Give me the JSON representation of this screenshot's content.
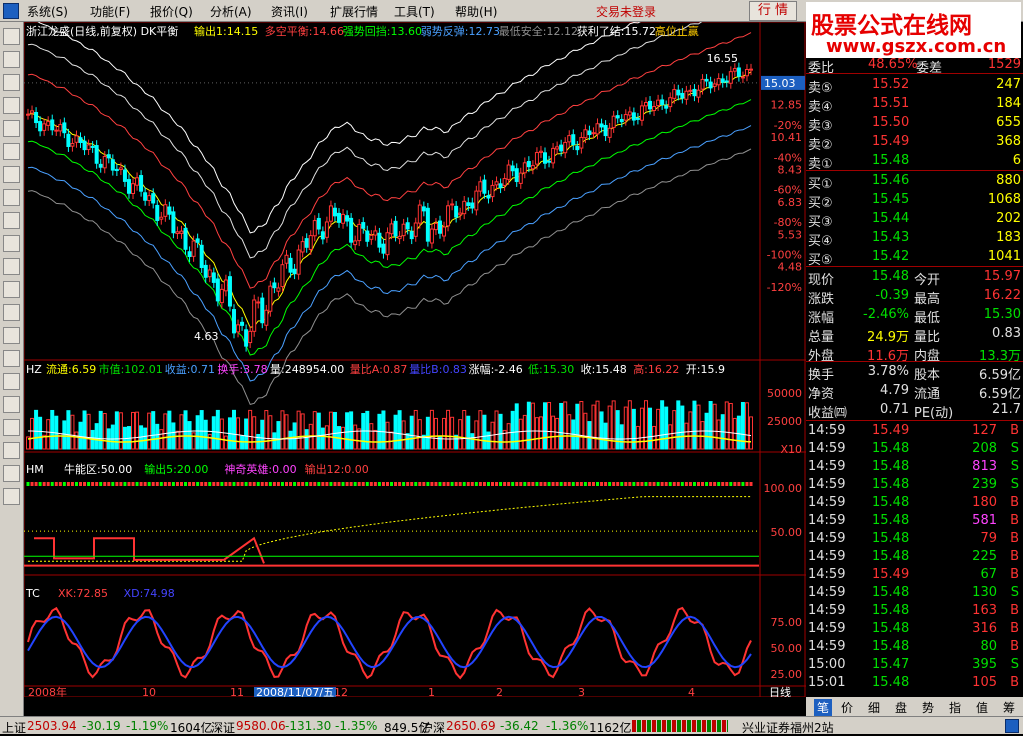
{
  "menu": [
    "系统(S)",
    "功能(F)",
    "报价(Q)",
    "分析(A)",
    "资讯(I)",
    "扩展行情",
    "工具(T)",
    "帮助(H)"
  ],
  "trade_status": "交易未登录",
  "quote_button": "行 情",
  "watermark": {
    "title": "股票公式在线网",
    "url": "www.gszx.com.cn"
  },
  "main": {
    "title": "浙江龙盛(日线,前复权) DK平衡",
    "indicators": [
      {
        "label": "输出1:14.15",
        "color": "#ffff00"
      },
      {
        "label": "多空平衡:14.66",
        "color": "#ff4040"
      },
      {
        "label": "强势回挡:13.60",
        "color": "#00ff00"
      },
      {
        "label": "弱势反弹:12.73",
        "color": "#4aa0ff"
      },
      {
        "label": "最低安全:12.12",
        "color": "#909090"
      },
      {
        "label": "获利了结:15.72",
        "color": "#ffffff"
      },
      {
        "label": "高位止赢",
        "color": "#ffcc00"
      }
    ],
    "price_tag": "15.03",
    "peak_label": "16.55",
    "trough_label": "4.63",
    "y_ticks": [
      "12.85",
      "-20%",
      "10.41",
      "-40%",
      "8.43",
      "-60%",
      "6.83",
      "-80%",
      "5.53",
      "-100%",
      "4.48",
      "-120%"
    ]
  },
  "vol": {
    "title": "HZ",
    "stats": [
      {
        "label": "流通:6.59",
        "color": "#ffff00"
      },
      {
        "label": "市值:102.01",
        "color": "#00e000"
      },
      {
        "label": "收益:0.71",
        "color": "#4aa0ff"
      },
      {
        "label": "换手:3.78",
        "color": "#ff44ff"
      },
      {
        "label": "量:248954.00",
        "color": "#ffffff"
      },
      {
        "label": "量比A:0.87",
        "color": "#ff4040"
      },
      {
        "label": "量比B:0.83",
        "color": "#4444ff"
      },
      {
        "label": "涨幅:-2.46",
        "color": "#ffffff"
      },
      {
        "label": "低:15.30",
        "color": "#00e000"
      },
      {
        "label": "收:15.48",
        "color": "#ffffff"
      },
      {
        "label": "高:16.22",
        "color": "#ff4040"
      },
      {
        "label": "开:15.9",
        "color": "#ffffff"
      }
    ],
    "y_ticks": [
      "50000",
      "25000",
      "X10"
    ]
  },
  "hm": {
    "title": "HM",
    "stats": [
      {
        "label": "牛能区:50.00",
        "color": "#ffffff"
      },
      {
        "label": "输出5:20.00",
        "color": "#00ff00"
      },
      {
        "label": "神奇英雄:0.00",
        "color": "#ff44ff"
      },
      {
        "label": "输出12:0.00",
        "color": "#ff4040"
      }
    ],
    "y_ticks": [
      "100.00",
      "50.00"
    ]
  },
  "tc": {
    "title": "TC",
    "stats": [
      {
        "label": "XK:72.85",
        "color": "#ff4040"
      },
      {
        "label": "XD:74.98",
        "color": "#4444ff"
      }
    ],
    "y_ticks": [
      "75.00",
      "50.00",
      "25.00"
    ]
  },
  "x_axis": {
    "labels": [
      "2008年",
      "10",
      "11",
      "2008/11/07/五",
      "12",
      "1",
      "2",
      "3",
      "4"
    ],
    "period": "日线"
  },
  "order_book": {
    "wei_bi_label": "委比",
    "wei_bi": "48.65%",
    "wei_cha_label": "委差",
    "wei_cha": "1529",
    "sells": [
      {
        "label": "卖⑤",
        "price": "15.52",
        "vol": "247"
      },
      {
        "label": "卖④",
        "price": "15.51",
        "vol": "184"
      },
      {
        "label": "卖③",
        "price": "15.50",
        "vol": "655"
      },
      {
        "label": "卖②",
        "price": "15.49",
        "vol": "368"
      },
      {
        "label": "卖①",
        "price": "15.48",
        "vol": "6"
      }
    ],
    "buys": [
      {
        "label": "买①",
        "price": "15.46",
        "vol": "880"
      },
      {
        "label": "买②",
        "price": "15.45",
        "vol": "1068"
      },
      {
        "label": "买③",
        "price": "15.44",
        "vol": "202"
      },
      {
        "label": "买④",
        "price": "15.43",
        "vol": "183"
      },
      {
        "label": "买⑤",
        "price": "15.42",
        "vol": "1041"
      }
    ]
  },
  "quote": [
    {
      "l1": "现价",
      "v1": "15.48",
      "c1": "green",
      "l2": "今开",
      "v2": "15.97",
      "c2": "red"
    },
    {
      "l1": "涨跌",
      "v1": "-0.39",
      "c1": "green",
      "l2": "最高",
      "v2": "16.22",
      "c2": "red"
    },
    {
      "l1": "涨幅",
      "v1": "-2.46%",
      "c1": "green",
      "l2": "最低",
      "v2": "15.30",
      "c2": "green"
    },
    {
      "l1": "总量",
      "v1": "24.9万",
      "c1": "yellow",
      "l2": "量比",
      "v2": "0.83",
      "c2": "white"
    },
    {
      "l1": "外盘",
      "v1": "11.6万",
      "c1": "red",
      "l2": "内盘",
      "v2": "13.3万",
      "c2": "green"
    }
  ],
  "info": [
    {
      "l1": "换手",
      "v1": "3.78%",
      "l2": "股本",
      "v2": "6.59亿"
    },
    {
      "l1": "净资",
      "v1": "4.79",
      "l2": "流通",
      "v2": "6.59亿"
    },
    {
      "l1": "收益㈣",
      "v1": "0.71",
      "l2": "PE(动)",
      "v2": "21.7"
    }
  ],
  "ticks": [
    {
      "t": "14:59",
      "p": "15.49",
      "v": "127",
      "vc": "red",
      "d": "B"
    },
    {
      "t": "14:59",
      "p": "15.48",
      "v": "208",
      "vc": "green",
      "d": "S"
    },
    {
      "t": "14:59",
      "p": "15.48",
      "v": "813",
      "vc": "purple",
      "d": "S"
    },
    {
      "t": "14:59",
      "p": "15.48",
      "v": "239",
      "vc": "green",
      "d": "S"
    },
    {
      "t": "14:59",
      "p": "15.48",
      "v": "180",
      "vc": "red",
      "d": "B"
    },
    {
      "t": "14:59",
      "p": "15.48",
      "v": "581",
      "vc": "purple",
      "d": "B"
    },
    {
      "t": "14:59",
      "p": "15.48",
      "v": "79",
      "vc": "red",
      "d": "B"
    },
    {
      "t": "14:59",
      "p": "15.48",
      "v": "225",
      "vc": "green",
      "d": "B"
    },
    {
      "t": "14:59",
      "p": "15.49",
      "v": "67",
      "vc": "green",
      "d": "B"
    },
    {
      "t": "14:59",
      "p": "15.48",
      "v": "130",
      "vc": "green",
      "d": "S"
    },
    {
      "t": "14:59",
      "p": "15.48",
      "v": "163",
      "vc": "red",
      "d": "B"
    },
    {
      "t": "14:59",
      "p": "15.48",
      "v": "316",
      "vc": "red",
      "d": "B"
    },
    {
      "t": "14:59",
      "p": "15.48",
      "v": "80",
      "vc": "green",
      "d": "B"
    },
    {
      "t": "15:00",
      "p": "15.47",
      "v": "395",
      "vc": "green",
      "d": "S"
    },
    {
      "t": "15:01",
      "p": "15.48",
      "v": "105",
      "vc": "red",
      "d": "B"
    }
  ],
  "right_tabs": [
    "笔",
    "价",
    "细",
    "盘",
    "势",
    "指",
    "值",
    "筹"
  ],
  "status": {
    "sh_label": "上证",
    "sh_val": "2503.94",
    "sh_chg": "-30.19",
    "sh_pct": "-1.19%",
    "sh_amt": "1604亿",
    "sz_label": "深证",
    "sz_val": "9580.06",
    "sz_chg": "-131.30",
    "sz_pct": "-1.35%",
    "sz_amt": "849.5亿",
    "hs_label": "沪深",
    "hs_val": "2650.69",
    "hs_chg": "-36.42",
    "hs_pct": "-1.36%",
    "hs_amt": "1162亿",
    "broker": "兴业证券福州2站"
  },
  "colors": {
    "up": "#ff3333",
    "down": "#00e000",
    "grid": "#800000",
    "axis": "#a00000"
  }
}
